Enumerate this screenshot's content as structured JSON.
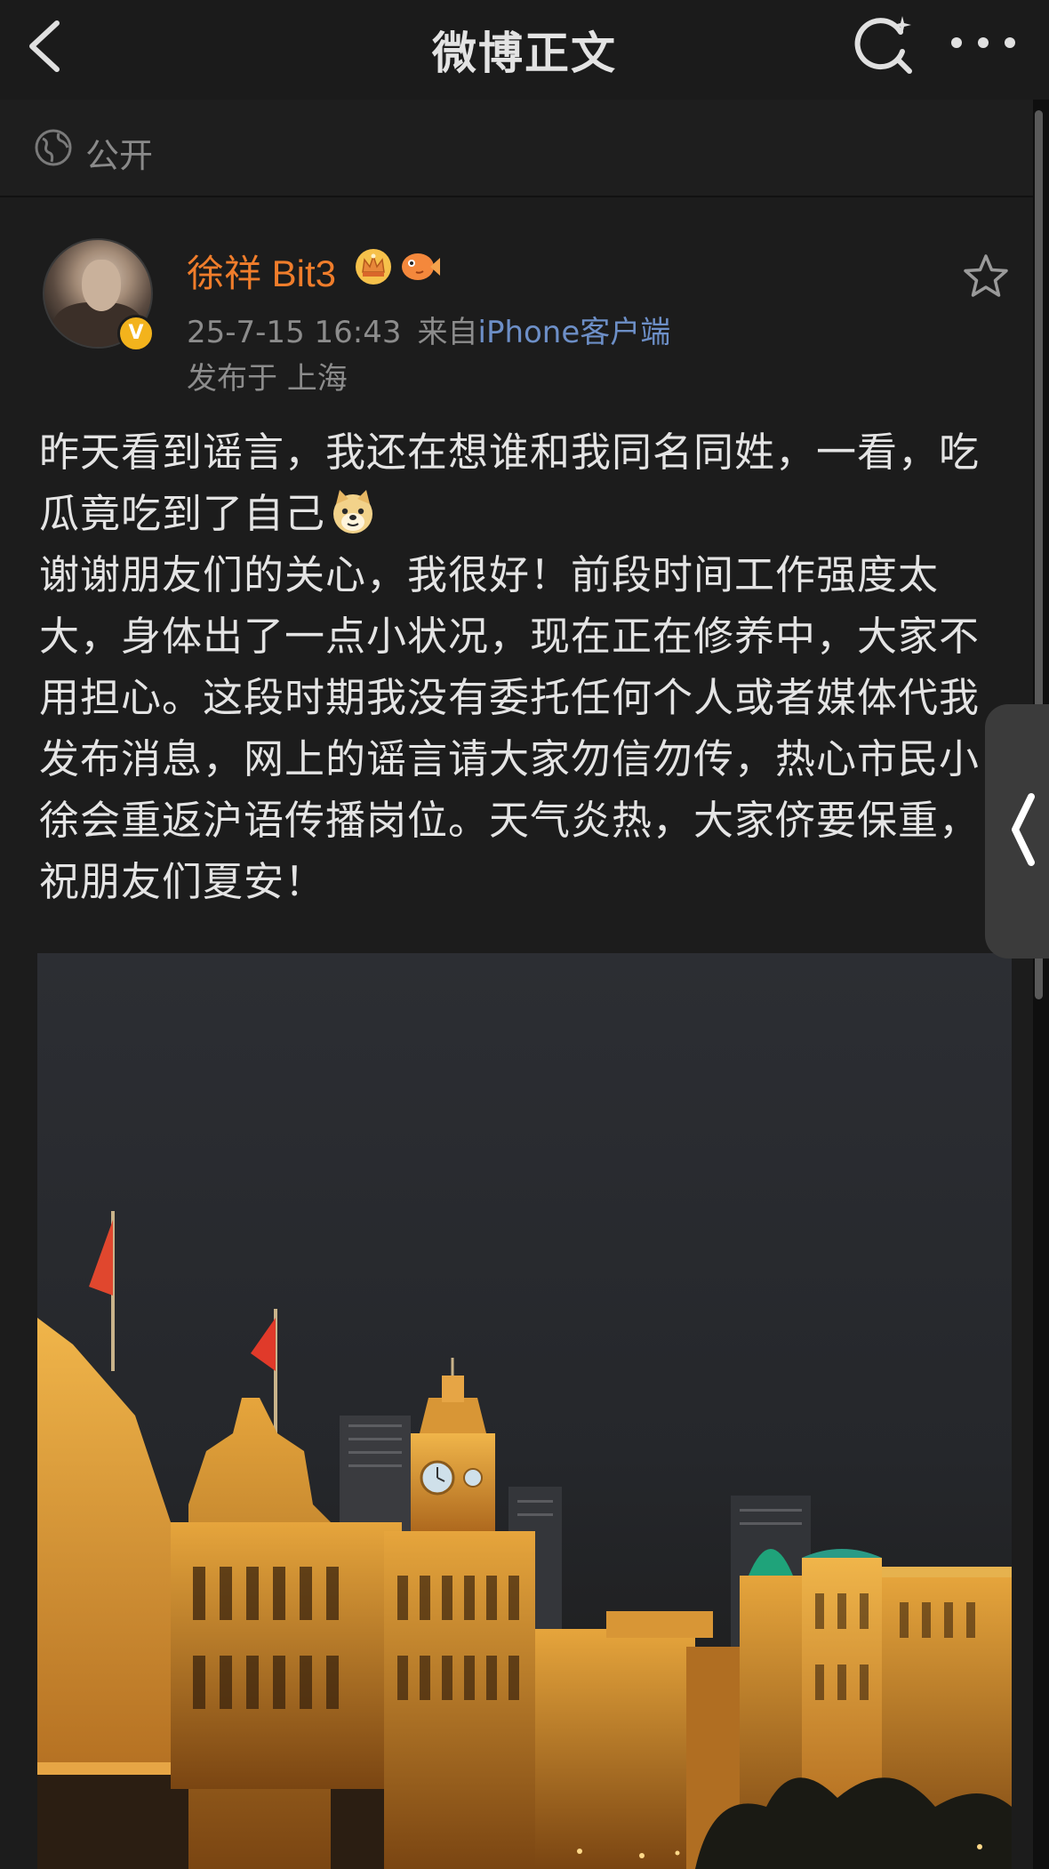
{
  "header": {
    "title": "微博正文",
    "back_icon": "chevron-left-icon",
    "search_icon": "search-icon",
    "more_icon": "more-horizontal-icon"
  },
  "visibility": {
    "label": "公开",
    "icon": "globe-icon"
  },
  "post": {
    "author": {
      "name": "徐祥 Bit3",
      "verified_badge": "V",
      "badges": [
        "crown-icon",
        "fish-icon"
      ]
    },
    "date": "25-7-15 16:43",
    "source_prefix": "来自",
    "source": "iPhone客户端",
    "location": "发布于 上海",
    "paragraphs": [
      "昨天看到谣言，我还在想谁和我同名同姓，一看，吃瓜竟吃到了自己",
      "谢谢朋友们的关心，我很好！前段时间工作强度太大，身体出了一点小状况，现在正在修养中，大家不用担心。这段时期我没有委托任何个人或者媒体代我发布消息，网上的谣言请大家勿信勿传，热心市民小徐会重返沪语传播岗位。天气炎热，大家侪要保重，祝朋友们夏安！"
    ],
    "emoji": "doge-icon",
    "favorite_icon": "star-icon",
    "image": "night view of Shanghai Bund buildings"
  },
  "colors": {
    "background": "#1c1c1c",
    "username": "#f07d2b",
    "link": "#6d8fc7",
    "badge": "#f3b31c"
  }
}
